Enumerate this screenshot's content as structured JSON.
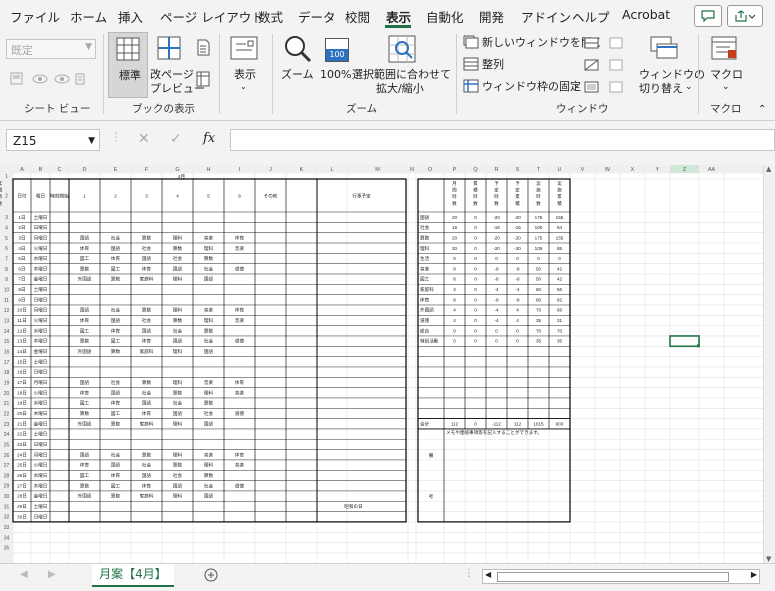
{
  "menu": {
    "tabs": [
      "ファイル",
      "ホーム",
      "挿入",
      "ページ レイアウト",
      "数式",
      "データ",
      "校閲",
      "表示",
      "自動化",
      "開発",
      "アドイン",
      "ヘルプ",
      "Acrobat"
    ],
    "active_tab": "表示"
  },
  "ribbon": {
    "sheet_view": {
      "dropdown_value": "既定",
      "group_label": "シート ビュー"
    },
    "book_view": {
      "normal_label": "標準",
      "page_break_label_1": "改ページ",
      "page_break_label_2": "プレビュー",
      "group_label": "ブックの表示"
    },
    "show": {
      "label": "表示"
    },
    "zoom": {
      "zoom_label": "ズーム",
      "hundred_label": "100%",
      "hundred_icon_text": "100",
      "fit_label_1": "選択範囲に合わせて",
      "fit_label_2": "拡大/縮小",
      "group_label": "ズーム"
    },
    "window": {
      "new_window_label": "新しいウィンドウを開く",
      "arrange_label": "整列",
      "freeze_label": "ウィンドウ枠の固定",
      "switch_label_1": "ウィンドウの",
      "switch_label_2": "切り替え",
      "group_label": "ウィンドウ"
    },
    "macro": {
      "label": "マクロ",
      "group_label": "マクロ"
    }
  },
  "formula_bar": {
    "name_box": "Z15",
    "fx_symbol": "fx",
    "value": ""
  },
  "grid": {
    "columns": [
      "A",
      "B",
      "C",
      "D",
      "E",
      "F",
      "G",
      "H",
      "I",
      "J",
      "K",
      "L",
      "M",
      "N",
      "O",
      "P",
      "Q",
      "R",
      "S",
      "T",
      "U",
      "V",
      "W",
      "X",
      "Y",
      "Z",
      "AA"
    ],
    "row_count": 35
  },
  "sheet": {
    "month_title": "4月",
    "left_headers": [
      "日付",
      "曜日",
      "時刻開始",
      "1",
      "2",
      "3",
      "4",
      "5",
      "6",
      "その他",
      "行事予定"
    ],
    "right_headers": [
      "月間時数",
      "累積時数",
      "予定時数",
      "予定累積",
      "実施時数",
      "実施累積",
      "年間時数"
    ],
    "dates": [
      "1日",
      "2日",
      "3日",
      "4日",
      "5日",
      "6日",
      "7日",
      "8日",
      "9日",
      "10日",
      "11日",
      "12日",
      "13日",
      "14日",
      "15日",
      "16日",
      "17日",
      "18日",
      "19日",
      "20日",
      "21日",
      "22日",
      "23日",
      "24日",
      "25日",
      "26日",
      "27日",
      "28日",
      "29日",
      "30日"
    ],
    "weekdays": [
      "土曜日",
      "日曜日",
      "月曜日",
      "火曜日",
      "水曜日",
      "木曜日",
      "金曜日",
      "土曜日",
      "日曜日",
      "月曜日",
      "火曜日",
      "水曜日",
      "木曜日",
      "金曜日",
      "土曜日",
      "日曜日",
      "月曜日",
      "火曜日",
      "水曜日",
      "木曜日",
      "金曜日",
      "土曜日",
      "日曜日",
      "月曜日",
      "火曜日",
      "水曜日",
      "木曜日",
      "金曜日",
      "土曜日",
      "日曜日"
    ],
    "lessons": [
      [],
      [],
      [
        "国語",
        "社会",
        "算数",
        "理科",
        "音楽",
        "体育"
      ],
      [
        "体育",
        "国語",
        "社会",
        "算数",
        "理科",
        "音楽"
      ],
      [
        "図工",
        "体育",
        "国語",
        "社会",
        "算数"
      ],
      [
        "算数",
        "図工",
        "体育",
        "国語",
        "社会",
        "道徳"
      ],
      [
        "外国語",
        "算数",
        "家庭科",
        "理科",
        "国語"
      ],
      [],
      [],
      [
        "国語",
        "社会",
        "算数",
        "理科",
        "音楽",
        "体育"
      ],
      [
        "体育",
        "国語",
        "社会",
        "算数",
        "理科",
        "音楽"
      ],
      [
        "図工",
        "体育",
        "国語",
        "社会",
        "算数"
      ],
      [
        "算数",
        "図工",
        "体育",
        "国語",
        "社会",
        "道徳"
      ],
      [
        "外国語",
        "算数",
        "家庭科",
        "理科",
        "国語"
      ],
      [],
      [],
      [
        "国語",
        "社会",
        "算数",
        "理科",
        "音楽",
        "体育"
      ],
      [
        "体育",
        "国語",
        "社会",
        "算数",
        "理科",
        "音楽"
      ],
      [
        "図工",
        "体育",
        "国語",
        "社会",
        "算数"
      ],
      [
        "算数",
        "図工",
        "体育",
        "国語",
        "社会",
        "道徳"
      ],
      [
        "外国語",
        "算数",
        "家庭科",
        "理科",
        "国語"
      ],
      [],
      [],
      [
        "国語",
        "社会",
        "算数",
        "理科",
        "音楽",
        "体育"
      ],
      [
        "体育",
        "国語",
        "社会",
        "算数",
        "理科",
        "音楽"
      ],
      [
        "図工",
        "体育",
        "国語",
        "社会",
        "算数"
      ],
      [
        "算数",
        "図工",
        "体育",
        "国語",
        "社会",
        "道徳"
      ],
      [
        "外国語",
        "算数",
        "家庭科",
        "理科",
        "国語"
      ],
      [],
      []
    ],
    "event_29": "昭和の日",
    "subjects": [
      {
        "name": "国語",
        "v": [
          "20",
          "0",
          "-20",
          "-20",
          "175",
          "155"
        ]
      },
      {
        "name": "社会",
        "v": [
          "16",
          "0",
          "-16",
          "-16",
          "100",
          "84"
        ]
      },
      {
        "name": "算数",
        "v": [
          "20",
          "0",
          "-20",
          "-20",
          "175",
          "155"
        ]
      },
      {
        "name": "理科",
        "v": [
          "20",
          "0",
          "-20",
          "-20",
          "105",
          "85"
        ]
      },
      {
        "name": "生活",
        "v": [
          "0",
          "0",
          "0",
          "0",
          "0",
          "0"
        ]
      },
      {
        "name": "音楽",
        "v": [
          "8",
          "0",
          "-8",
          "-8",
          "50",
          "42"
        ]
      },
      {
        "name": "図工",
        "v": [
          "8",
          "0",
          "-8",
          "-8",
          "50",
          "42"
        ]
      },
      {
        "name": "家庭科",
        "v": [
          "4",
          "0",
          "-4",
          "-4",
          "60",
          "56"
        ]
      },
      {
        "name": "体育",
        "v": [
          "8",
          "0",
          "-8",
          "-8",
          "90",
          "82"
        ]
      },
      {
        "name": "外国語",
        "v": [
          "4",
          "0",
          "-4",
          "4",
          "70",
          "66"
        ]
      },
      {
        "name": "道徳",
        "v": [
          "4",
          "0",
          "-4",
          "4",
          "35",
          "31"
        ]
      },
      {
        "name": "総合",
        "v": [
          "0",
          "0",
          "0",
          "0",
          "70",
          "70"
        ]
      },
      {
        "name": "特別活動",
        "v": [
          "0",
          "0",
          "0",
          "0",
          "35",
          "35"
        ]
      }
    ],
    "total_label": "合計",
    "total_values": [
      "112",
      "0",
      "-112",
      "112",
      "1015",
      "903"
    ],
    "memo_note": "メモや連絡事項等を記入することができます。",
    "remarks_label_1": "備",
    "remarks_label_2": "考"
  },
  "status": {
    "sheet_tab": "月案【4月】"
  }
}
